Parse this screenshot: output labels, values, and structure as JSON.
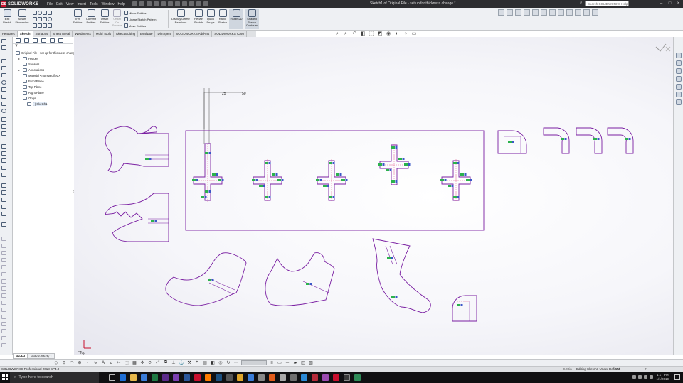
{
  "app": {
    "logo_ds": "DS",
    "logo_text": "SOLIDWORKS",
    "document_title": "Sketch1 of Original File - set up for thickness change *"
  },
  "menu": [
    "File",
    "Edit",
    "View",
    "Insert",
    "Tools",
    "Window",
    "Help"
  ],
  "search": {
    "placeholder": "Search SOLIDWORKS Help"
  },
  "ribbon": {
    "exit_sketch": "Exit Sketch",
    "smart_dimension": "Smart Dimension",
    "trim_entities": "Trim Entities",
    "convert_entities": "Convert Entities",
    "offset_entities": "Offset Entities",
    "offset_on_surface": "Offset On Surface",
    "mirror_entities": "Mirror Entities",
    "linear_sketch_pattern": "Linear Sketch Pattern",
    "move_entities": "Move Entities",
    "display_delete_relations": "Display/Delete Relations",
    "repair_sketch": "Repair Sketch",
    "quick_snaps": "Quick Snaps",
    "rapid_sketch": "Rapid Sketch",
    "instant2d": "Instant2D",
    "shaded_sketch_contours": "Shaded Sketch Contours"
  },
  "tabs": [
    {
      "label": "Features",
      "active": false
    },
    {
      "label": "Sketch",
      "active": true
    },
    {
      "label": "Surfaces",
      "active": false
    },
    {
      "label": "Sheet Metal",
      "active": false
    },
    {
      "label": "Weldments",
      "active": false
    },
    {
      "label": "Mold Tools",
      "active": false
    },
    {
      "label": "Direct Editing",
      "active": false
    },
    {
      "label": "Evaluate",
      "active": false
    },
    {
      "label": "DimXpert",
      "active": false
    },
    {
      "label": "SOLIDWORKS Add-Ins",
      "active": false
    },
    {
      "label": "SOLIDWORKS CAM",
      "active": false
    }
  ],
  "feature_tree": [
    {
      "label": "Original File - set up for thickness change",
      "level": 0,
      "twist": "",
      "icon": "part-icon"
    },
    {
      "label": "History",
      "level": 1,
      "twist": "▸",
      "icon": "history-icon"
    },
    {
      "label": "Sensors",
      "level": 1,
      "twist": "",
      "icon": "sensors-icon"
    },
    {
      "label": "Annotations",
      "level": 1,
      "twist": "▸",
      "icon": "annotations-icon"
    },
    {
      "label": "Material <not specified>",
      "level": 1,
      "twist": "",
      "icon": "material-icon"
    },
    {
      "label": "Front Plane",
      "level": 1,
      "twist": "",
      "icon": "plane-icon"
    },
    {
      "label": "Top Plane",
      "level": 1,
      "twist": "",
      "icon": "plane-icon"
    },
    {
      "label": "Right Plane",
      "level": 1,
      "twist": "",
      "icon": "plane-icon"
    },
    {
      "label": "Origin",
      "level": 1,
      "twist": "",
      "icon": "origin-icon"
    },
    {
      "label": "(-) Sketch1",
      "level": 2,
      "twist": "",
      "icon": "sketch-icon"
    }
  ],
  "model_tabs": [
    {
      "label": "Model",
      "active": true
    },
    {
      "label": "Motion Study 1",
      "active": false
    }
  ],
  "canvas": {
    "dimension_1": "25",
    "dimension_2": "50",
    "triad_label": "*Top"
  },
  "colors": {
    "sketch_line": "#7a1fa2",
    "relation_green": "#2bb24c",
    "relation_blue": "#3a57c7",
    "construction_pink": "#e05a8a",
    "titlebar": "#2d2d30",
    "ribbon": "#eef0f3"
  },
  "status": {
    "edition": "SOLIDWORKS Professional 2018 SP4.0",
    "coord": "-0.00in",
    "state": "Editing Sketch1 Under Defined",
    "units": "IPS"
  },
  "taskbar": {
    "search_placeholder": "Type here to search",
    "time": "1:17 PM",
    "date": "1/1/2019"
  }
}
